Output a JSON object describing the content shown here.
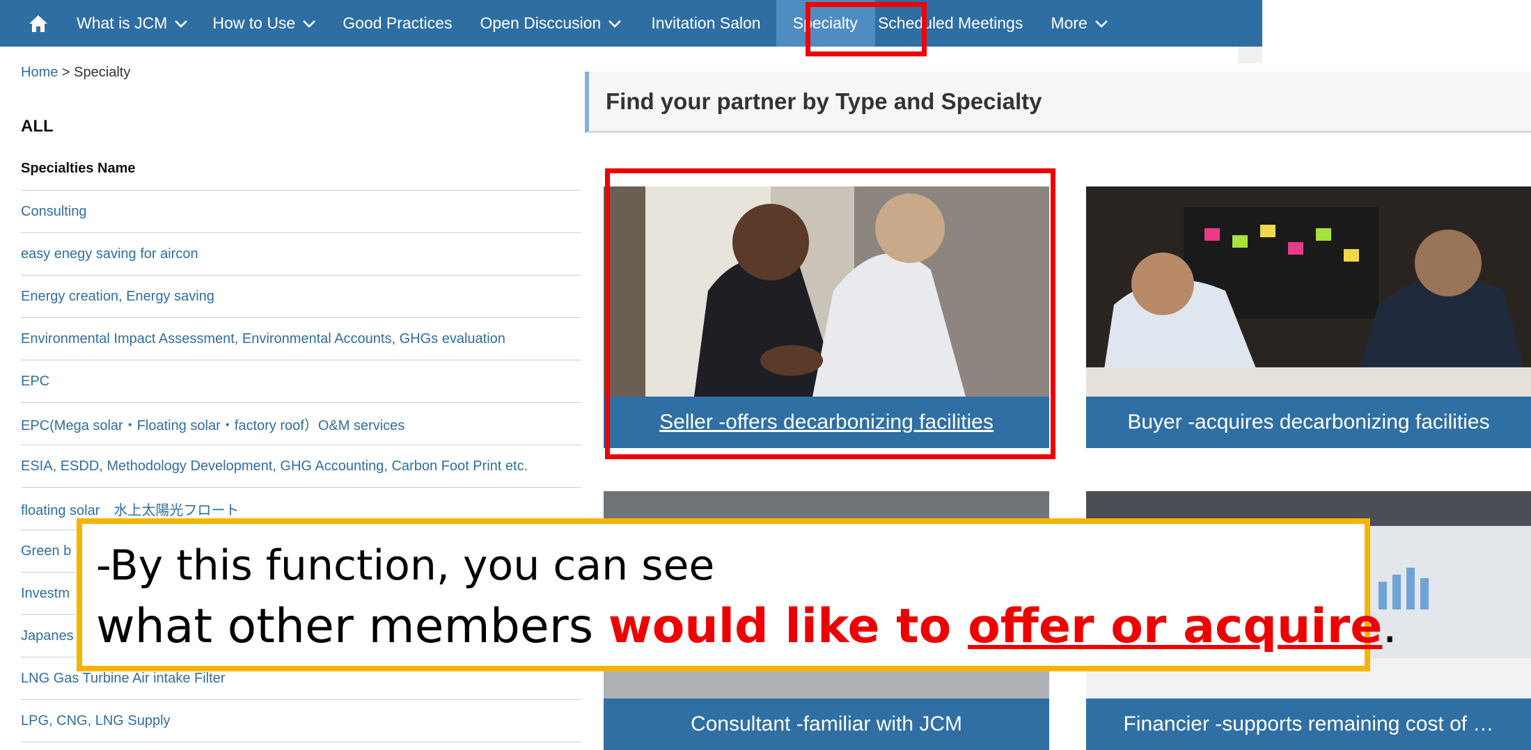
{
  "nav": {
    "home_icon": "home-icon",
    "items": [
      {
        "label": "What is JCM",
        "dropdown": true
      },
      {
        "label": "How to Use",
        "dropdown": true
      },
      {
        "label": "Good Practices",
        "dropdown": false
      },
      {
        "label": "Open Disccusion",
        "dropdown": true
      },
      {
        "label": "Invitation Salon",
        "dropdown": false
      },
      {
        "label": "Specialty",
        "dropdown": false,
        "active": true
      },
      {
        "label": "Scheduled Meetings",
        "dropdown": false
      },
      {
        "label": "More",
        "dropdown": true
      }
    ]
  },
  "breadcrumb": {
    "home": "Home",
    "separator": ">",
    "current": "Specialty"
  },
  "left": {
    "heading": "ALL",
    "column_header": "Specialties Name",
    "specialties": [
      "Consulting",
      "easy enegy saving for aircon",
      "Energy creation, Energy saving",
      "Environmental Impact Assessment, Environmental Accounts, GHGs evaluation",
      "EPC",
      "EPC(Mega solar・Floating solar・factory roof）O&M services",
      "ESIA, ESDD, Methodology Development, GHG Accounting, Carbon Foot Print etc.",
      "floating solar　水上太陽光フロート",
      "Green b",
      "Investm",
      "Japanes",
      "LNG Gas Turbine Air intake Filter",
      "LPG, CNG, LNG Supply"
    ]
  },
  "find_section": {
    "title": "Find your partner by Type and Specialty",
    "cards": [
      {
        "label": "Seller -offers decarbonizing facilities"
      },
      {
        "label": "Buyer -acquires decarbonizing facilities"
      },
      {
        "label": "Consultant -familiar with JCM"
      },
      {
        "label": "Financier -supports remaining cost of …"
      }
    ]
  },
  "callout": {
    "line1": "-By this function, you can see",
    "line2_prefix": "what other members ",
    "line2_highlight": "would like to ",
    "line2_underlined": "offer or acquire",
    "line2_suffix": "."
  },
  "colors": {
    "nav_bg": "#2e6ea3",
    "nav_active": "#4f8cc2",
    "link": "#2e6ea3",
    "highlight_red": "#ee0000",
    "callout_border": "#f5b400"
  }
}
